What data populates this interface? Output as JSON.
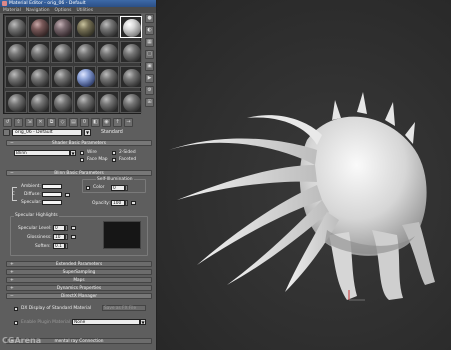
{
  "window": {
    "title": "Material Editor - orig_06 - Default",
    "menus": [
      "Material",
      "Navigation",
      "Options",
      "Utilities"
    ]
  },
  "sample_slots": {
    "rows": 4,
    "cols": 6,
    "active_index": 5,
    "blue_index": 15
  },
  "material": {
    "name": "orig_06 - Default",
    "dropdown_glyph": "▼",
    "type_label": "Standard"
  },
  "shader_basic": {
    "header": "Shader Basic Parameters",
    "shader": "Blinn",
    "wire": "Wire",
    "two_sided": "2-Sided",
    "face_map": "Face Map",
    "faceted": "Faceted"
  },
  "blinn_basic": {
    "header": "Blinn Basic Parameters",
    "self_illum_title": "Self-Illumination",
    "color_label": "Color",
    "color_value": "0",
    "ambient": "Ambient:",
    "diffuse": "Diffuse:",
    "specular": "Specular:",
    "opacity_label": "Opacity:",
    "opacity_value": "100",
    "lock_glyph": "C"
  },
  "specular_highlights": {
    "title": "Specular Highlights",
    "level_label": "Specular Level:",
    "level_value": "0",
    "gloss_label": "Glossiness:",
    "gloss_value": "10",
    "soften_label": "Soften:",
    "soften_value": "0.1"
  },
  "rollouts": [
    "Extended Parameters",
    "SuperSampling",
    "Maps",
    "Dynamics Properties",
    "DirectX Manager"
  ],
  "directx": {
    "dx_display": "DX Display of Standard Material",
    "save_fx": "Save as FX File",
    "enable_plugin": "Enable Plugin Material",
    "plugin_value": "None"
  },
  "last_rollout": "mental ray Connection",
  "watermark": "CGArena",
  "colors": {
    "panel": "#5e5e5e",
    "viewport": "#2e2e2e",
    "titlebar": "#2b4f86"
  },
  "icons": [
    "material-ball-icon",
    "backlight-icon",
    "background-icon",
    "sample-uv-icon",
    "video-color-icon",
    "make-preview-icon",
    "options-icon",
    "select-by-material-icon",
    "get-material-icon",
    "put-to-scene-icon",
    "assign-material-icon",
    "reset-icon",
    "copy-icon",
    "unique-icon",
    "library-icon",
    "effects-channel-icon",
    "show-map-icon",
    "show-end-result-icon",
    "go-parent-icon",
    "go-sibling-icon",
    "pick-material-icon"
  ]
}
